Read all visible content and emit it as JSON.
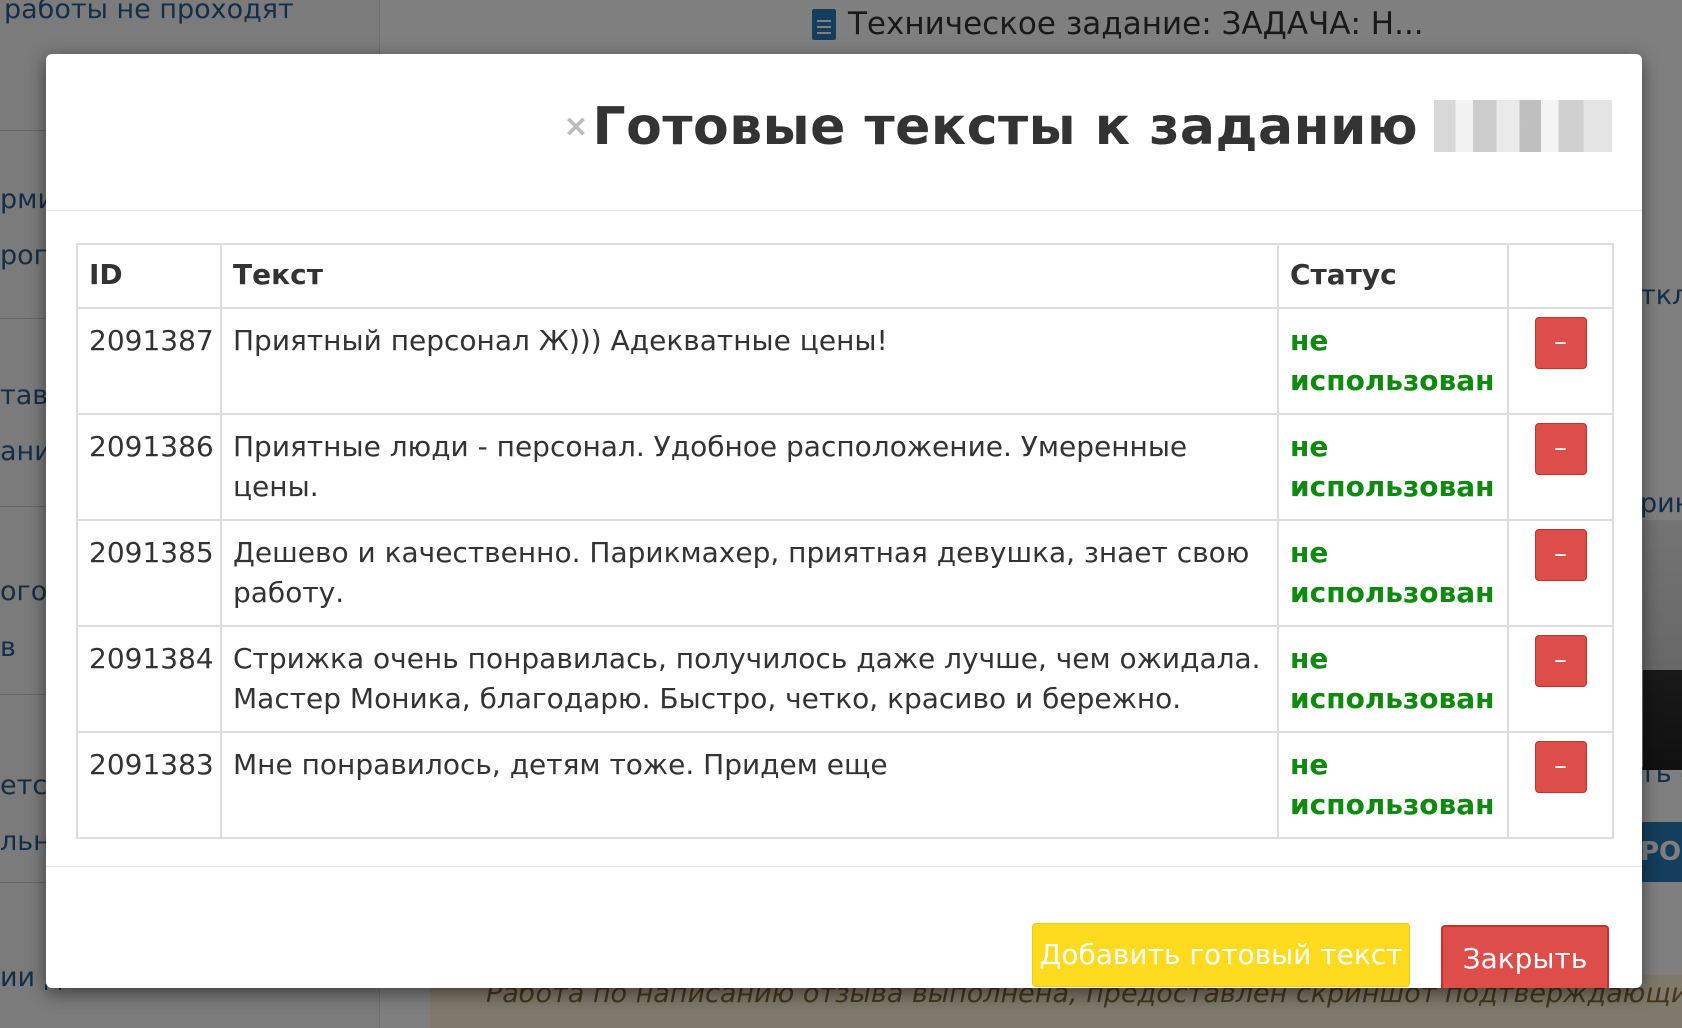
{
  "background": {
    "sidebar_texts": [
      "работы не проходят",
      "рми",
      "рог",
      "тави",
      "ания",
      "ого :",
      "в",
      "ется",
      "льн",
      "ии д"
    ],
    "page_title": "Техническое задание: ЗАДАЧА: Н...",
    "right_texts": [
      "ткло",
      "рин",
      "ть с"
    ],
    "blue_button_label": "РО",
    "notice_text": "Работа по написанию отзыва выполнена, предоставлен скриншот подтверждающий"
  },
  "modal": {
    "close_symbol": "×",
    "title": "Готовые тексты к заданию",
    "table": {
      "headers": {
        "id": "ID",
        "text": "Текст",
        "status": "Статус",
        "actions": ""
      },
      "rows": [
        {
          "id": "2091387",
          "text": "Приятный персонал Ж))) Адекватные цены!",
          "status": "не использован",
          "action_label": "–"
        },
        {
          "id": "2091386",
          "text": "Приятные люди - персонал. Удобное расположение. Умеренные цены.",
          "status": "не использован",
          "action_label": "–"
        },
        {
          "id": "2091385",
          "text": "Дешево и качественно. Парикмахер, приятная девушка, знает свою работу.",
          "status": "не использован",
          "action_label": "–"
        },
        {
          "id": "2091384",
          "text": "Стрижка очень понравилась, получилось даже лучше, чем ожидала. Мастер Моника, благодарю. Быстро, четко, красиво и бережно.",
          "status": "не использован",
          "action_label": "–"
        },
        {
          "id": "2091383",
          "text": "Мне понравилось, детям тоже. Придем еще",
          "status": "не использован",
          "action_label": "–"
        }
      ]
    },
    "footer": {
      "add_label": "Добавить готовый текст",
      "close_label": "Закрыть"
    }
  },
  "colors": {
    "status_green": "#0e8a0e",
    "danger_red": "#dd4d4a",
    "add_yellow": "#fedb1e"
  }
}
